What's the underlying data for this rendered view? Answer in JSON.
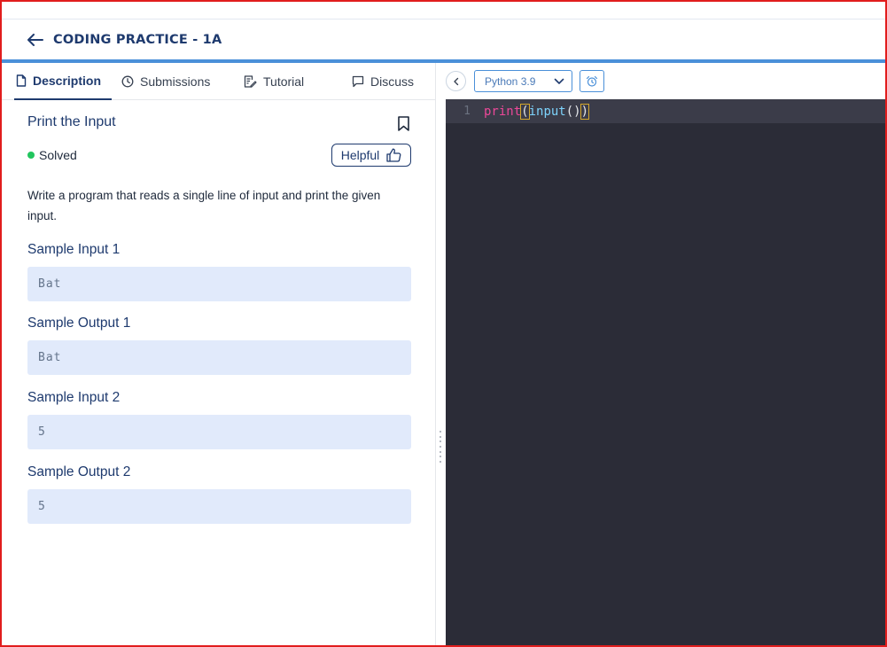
{
  "header": {
    "back_icon": "arrow-left-icon",
    "title": "CODING PRACTICE - 1A"
  },
  "tabs": [
    {
      "label": "Description",
      "icon": "file-icon",
      "active": true
    },
    {
      "label": "Submissions",
      "icon": "clock-icon",
      "active": false
    },
    {
      "label": "Tutorial",
      "icon": "edit-document-icon",
      "active": false
    },
    {
      "label": "Discuss",
      "icon": "chat-icon",
      "active": false
    }
  ],
  "problem": {
    "title": "Print the Input",
    "status": "Solved",
    "helpful_label": "Helpful",
    "description": "Write a program that reads a single line of input and print the given input.",
    "samples": [
      {
        "label": "Sample Input 1",
        "value": "Bat"
      },
      {
        "label": "Sample Output 1",
        "value": "Bat"
      },
      {
        "label": "Sample Input 2",
        "value": "5"
      },
      {
        "label": "Sample Output 2",
        "value": "5"
      }
    ]
  },
  "editor": {
    "language": "Python 3.9",
    "line_number": "1",
    "code": {
      "kw": "print",
      "open1": "(",
      "fn": "input",
      "parens": "()",
      "close1": ")"
    }
  },
  "colors": {
    "accent": "#1e3a6e",
    "blue_line": "#4a90d9",
    "solved": "#22c55e",
    "sample_bg": "#e1eafb",
    "editor_bg": "#2b2c37"
  }
}
